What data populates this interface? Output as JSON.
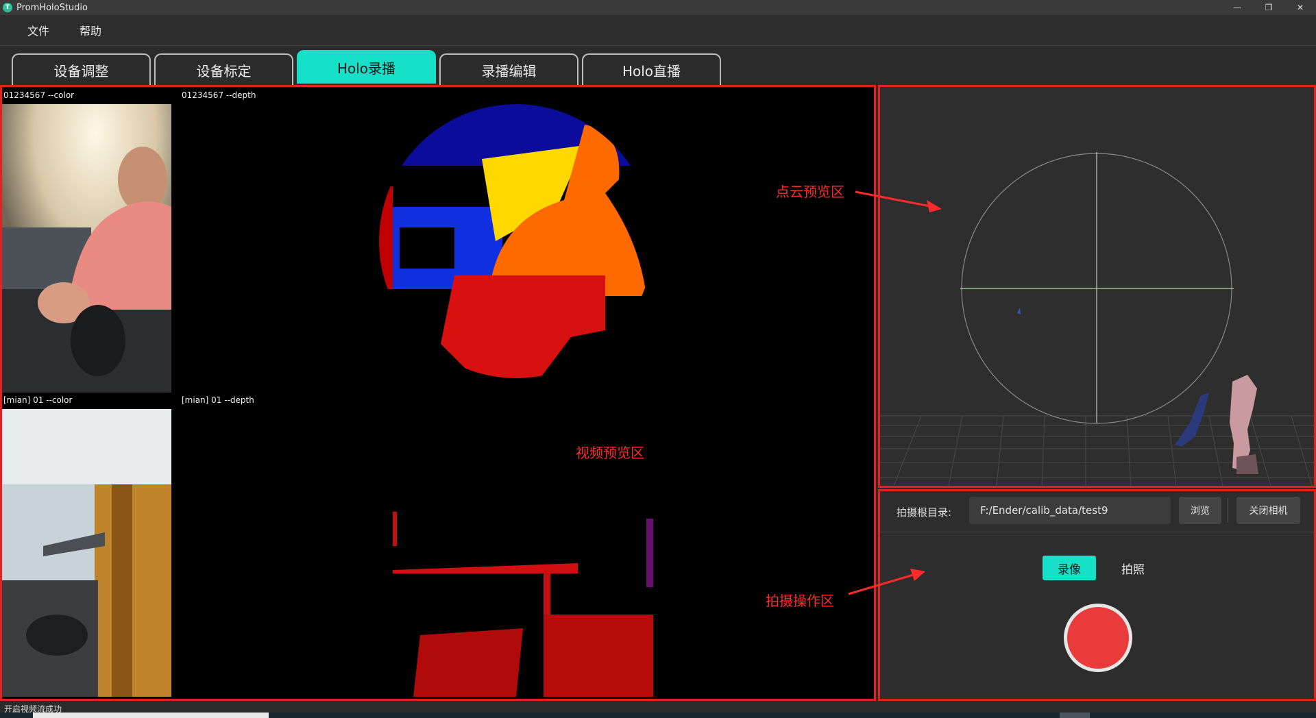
{
  "window": {
    "title": "PromHoloStudio",
    "icon_letter": "T",
    "controls": {
      "minimize": "—",
      "restore": "❐",
      "close": "✕"
    }
  },
  "menu": {
    "items": [
      "文件",
      "帮助"
    ]
  },
  "tabs": [
    {
      "label": "设备调整",
      "active": false
    },
    {
      "label": "设备标定",
      "active": false
    },
    {
      "label": "Holo录播",
      "active": true
    },
    {
      "label": "录播编辑",
      "active": false
    },
    {
      "label": "Holo直播",
      "active": false
    }
  ],
  "video": {
    "streams": [
      {
        "color_label": "01234567 --color",
        "depth_label": "01234567 --depth"
      },
      {
        "color_label": "[mian] 01 --color",
        "depth_label": "[mian] 01 --depth"
      }
    ]
  },
  "capture": {
    "root_label": "拍摄根目录:",
    "root_path": "F:/Ender/calib_data/test9",
    "browse_label": "浏览",
    "close_camera_label": "关闭相机",
    "mode_record": "录像",
    "mode_photo": "拍照"
  },
  "annotations": {
    "cloud": "点云预览区",
    "video": "视频预览区",
    "ops": "拍摄操作区"
  },
  "status": {
    "text": "开启视频流成功"
  },
  "colors": {
    "accent": "#17e0c8",
    "highlight_border": "#e22222",
    "record_button": "#e93b3b"
  }
}
